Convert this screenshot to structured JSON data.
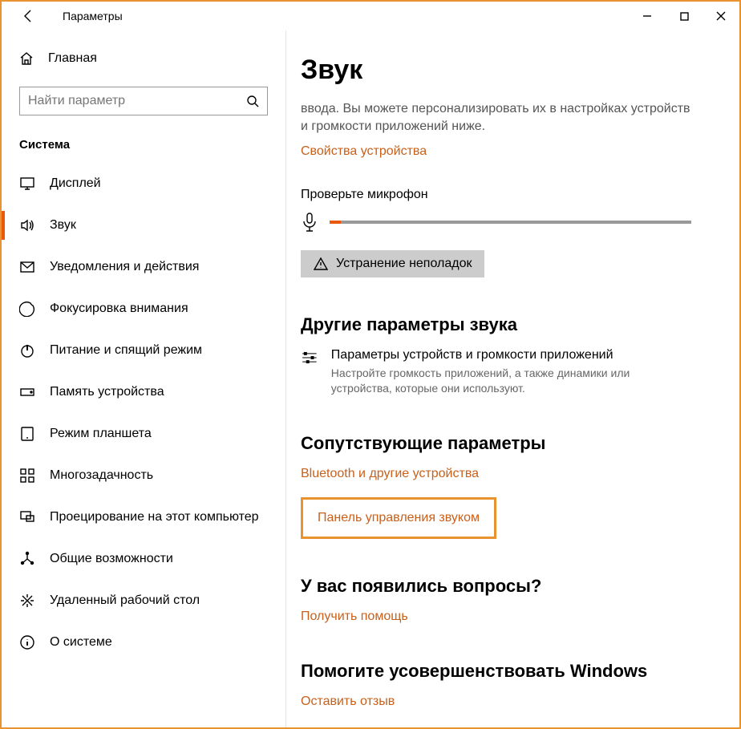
{
  "window": {
    "title": "Параметры"
  },
  "sidebar": {
    "home_label": "Главная",
    "search_placeholder": "Найти параметр",
    "category_label": "Система",
    "items": [
      {
        "label": "Дисплей"
      },
      {
        "label": "Звук"
      },
      {
        "label": "Уведомления и действия"
      },
      {
        "label": "Фокусировка внимания"
      },
      {
        "label": "Питание и спящий режим"
      },
      {
        "label": "Память устройства"
      },
      {
        "label": "Режим планшета"
      },
      {
        "label": "Многозадачность"
      },
      {
        "label": "Проецирование на этот компьютер"
      },
      {
        "label": "Общие возможности"
      },
      {
        "label": "Удаленный рабочий стол"
      },
      {
        "label": "О системе"
      }
    ]
  },
  "content": {
    "page_title": "Звук",
    "intro_text": "ввода. Вы можете персонализировать их в настройках устройств и громкости приложений ниже.",
    "device_properties_link": "Свойства устройства",
    "mic_check_label": "Проверьте микрофон",
    "troubleshoot_label": "Устранение неполадок",
    "other_options_heading": "Другие параметры звука",
    "advanced": {
      "title": "Параметры устройств и громкости приложений",
      "desc": "Настройте громкость приложений, а также динамики или устройства, которые они используют."
    },
    "related_heading": "Сопутствующие параметры",
    "related_links": {
      "bluetooth": "Bluetooth и другие устройства",
      "sound_cp": "Панель управления звуком"
    },
    "help_heading": "У вас появились вопросы?",
    "help_link": "Получить помощь",
    "feedback_heading": "Помогите усовершенствовать Windows",
    "feedback_link": "Оставить отзыв"
  }
}
